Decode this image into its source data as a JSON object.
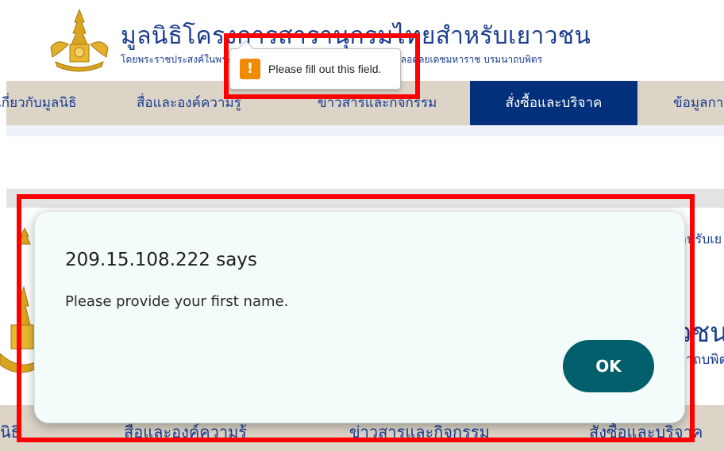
{
  "site": {
    "title": "มูลนิธิโครงการสารานุกรมไทยสำหรับเยาวชน",
    "subtitle": "โดยพระราชประสงค์ในพระบาทสมเด็จพระบรมชนกาธิเบศร มหาภูมิพลอดุลยเดชมหาราช บรมนาถบพิตร"
  },
  "nav": {
    "items": [
      {
        "label": "เกี่ยวกับมูลนิธิ"
      },
      {
        "label": "สื่อและองค์ความรู้"
      },
      {
        "label": "ข่าวสารและกิจกรรม"
      },
      {
        "label": "สั่งซื้อและบริจาค"
      },
      {
        "label": "ข้อมูลการ"
      }
    ],
    "active_index": 3
  },
  "tooltip": {
    "icon": "!",
    "message": "Please fill out this field."
  },
  "background": {
    "right_text_1": "ำหรับเย",
    "right_text_2": "วชน",
    "right_text_3": "นาถบพิตร",
    "nav_items": [
      {
        "label": "นิธิ"
      },
      {
        "label": "สื่อและองค์ความรู้"
      },
      {
        "label": "ข่าวสารและกิจกรรม"
      },
      {
        "label": "สั่งซื้อและบริจาค"
      }
    ]
  },
  "dialog": {
    "title": "209.15.108.222 says",
    "message": "Please provide your first name.",
    "ok_label": "OK"
  },
  "colors": {
    "brand_blue": "#1a3d8f",
    "nav_active": "#03307a",
    "nav_bg": "#dcd4c7",
    "ok_button": "#005f6b",
    "highlight": "#ff0000",
    "warning": "#f08b00"
  }
}
